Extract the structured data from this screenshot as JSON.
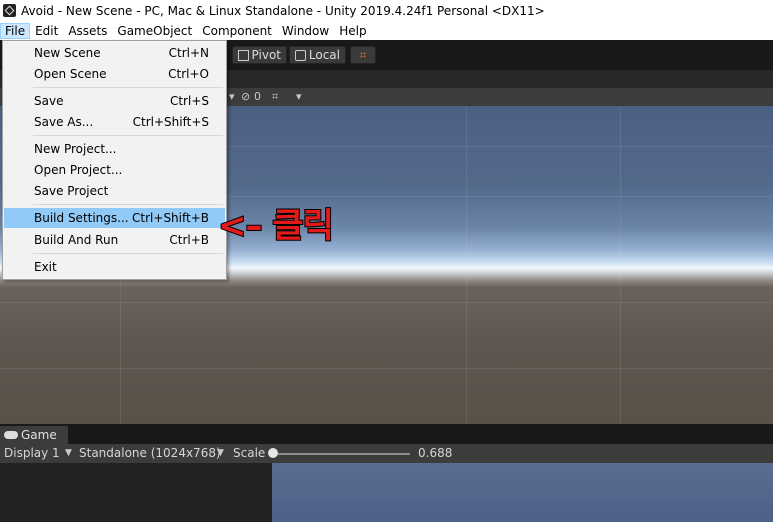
{
  "window": {
    "title": "Avoid - New Scene - PC, Mac & Linux Standalone - Unity 2019.4.24f1 Personal <DX11>"
  },
  "menubar": [
    "File",
    "Edit",
    "Assets",
    "GameObject",
    "Component",
    "Window",
    "Help"
  ],
  "toolbar": {
    "pivot": "Pivot",
    "local": "Local",
    "snap_icon": "grid-snap-icon"
  },
  "scene_toolbar": {
    "visibility_count": "0"
  },
  "file_menu": {
    "items": [
      {
        "label": "New Scene",
        "shortcut": "Ctrl+N"
      },
      {
        "label": "Open Scene",
        "shortcut": "Ctrl+O"
      },
      {
        "label": "Save",
        "shortcut": "Ctrl+S"
      },
      {
        "label": "Save As...",
        "shortcut": "Ctrl+Shift+S"
      },
      {
        "label": "New Project...",
        "shortcut": ""
      },
      {
        "label": "Open Project...",
        "shortcut": ""
      },
      {
        "label": "Save Project",
        "shortcut": ""
      },
      {
        "label": "Build Settings...",
        "shortcut": "Ctrl+Shift+B",
        "highlighted": true
      },
      {
        "label": "Build And Run",
        "shortcut": "Ctrl+B"
      },
      {
        "label": "Exit",
        "shortcut": ""
      }
    ]
  },
  "annotation": {
    "text": "<– 클릭",
    "color": "#e21a1a"
  },
  "game_panel": {
    "tab": "Game",
    "display": "Display 1",
    "resolution": "Standalone (1024x768)",
    "scale_label": "Scale",
    "scale_value": "0.688"
  },
  "colors": {
    "highlight": "#91c9f7",
    "editor_dark": "#3c3c3c",
    "annotation": "#e21a1a"
  }
}
